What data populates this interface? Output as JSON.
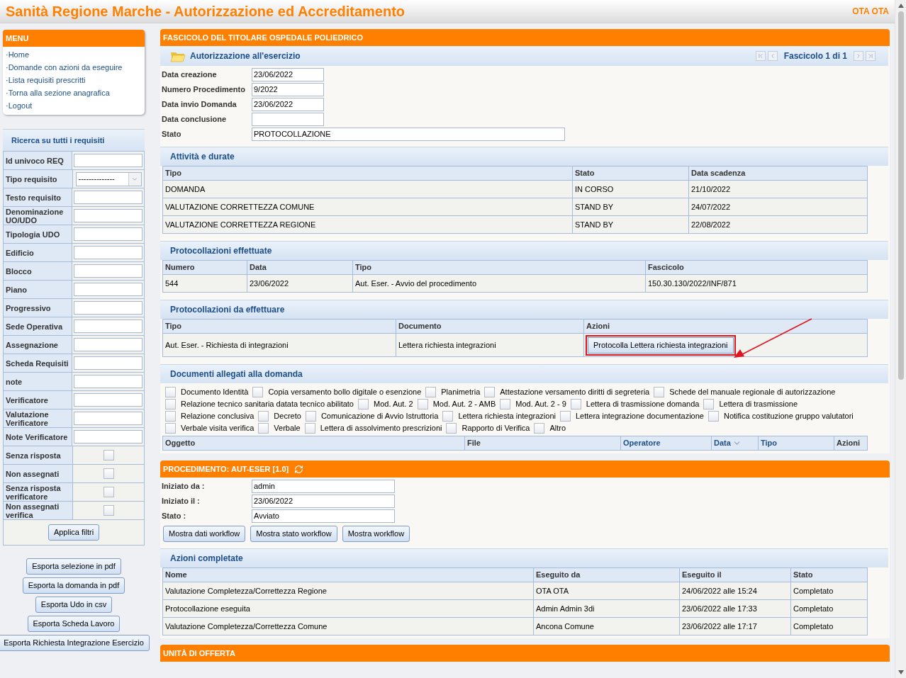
{
  "header": {
    "title": "Sanità Regione Marche - Autorizzazione ed Accreditamento",
    "user": "OTA OTA"
  },
  "menu": {
    "title": "MENU",
    "items": [
      "·Home",
      "·Domande con azioni da eseguire",
      "·Lista requisiti prescritti",
      "·Torna alla sezione anagrafica",
      "·Logout"
    ]
  },
  "search": {
    "title": "Ricerca su tutti i requisiti",
    "filters": [
      {
        "label": "Id univoco REQ",
        "kind": "text"
      },
      {
        "label": "Tipo requisito",
        "kind": "select",
        "value": "--------------"
      },
      {
        "label": "Testo requisito",
        "kind": "text"
      },
      {
        "label": "Denominazione UO/UDO",
        "kind": "text"
      },
      {
        "label": "Tipologia UDO",
        "kind": "text"
      },
      {
        "label": "Edificio",
        "kind": "text"
      },
      {
        "label": "Blocco",
        "kind": "text"
      },
      {
        "label": "Piano",
        "kind": "text"
      },
      {
        "label": "Progressivo",
        "kind": "text"
      },
      {
        "label": "Sede Operativa",
        "kind": "text"
      },
      {
        "label": "Assegnazione",
        "kind": "text"
      },
      {
        "label": "Scheda Requisiti",
        "kind": "text"
      },
      {
        "label": "note",
        "kind": "text"
      },
      {
        "label": "Verificatore",
        "kind": "text"
      },
      {
        "label": "Valutazione Verificatore",
        "kind": "text"
      },
      {
        "label": "Note Verificatore",
        "kind": "text"
      },
      {
        "label": "Senza risposta",
        "kind": "checkbox",
        "checked": false
      },
      {
        "label": "Non assegnati",
        "kind": "checkbox",
        "checked": false
      },
      {
        "label": "Senza risposta verificatore",
        "kind": "checkbox",
        "checked": false
      },
      {
        "label": "Non assegnati verifica",
        "kind": "checkbox",
        "checked": false
      }
    ],
    "apply_button": "Applica filtri"
  },
  "export_buttons": [
    "Esporta selezione in pdf",
    "Esporta la domanda in pdf",
    "Esporta Udo in csv",
    "Esporta Scheda Lavoro",
    "Esporta Richiesta Integrazione Esercizio"
  ],
  "fascicolo": {
    "title": "FASCICOLO DEL TITOLARE OSPEDALE POLIEDRICO",
    "subtitle": "Autorizzazione all'esercizio",
    "pager": "Fascicolo 1 di 1",
    "fields": [
      {
        "label": "Data creazione",
        "value": "23/06/2022",
        "wide": false
      },
      {
        "label": "Numero Procedimento",
        "value": "9/2022",
        "wide": false
      },
      {
        "label": "Data invio Domanda",
        "value": "23/06/2022",
        "wide": false
      },
      {
        "label": "Data conclusione",
        "wide": false
      },
      {
        "label": "Stato",
        "value": "PROTOCOLLAZIONE",
        "wide": true
      }
    ]
  },
  "attivita": {
    "title": "Attività e durate",
    "columns": [
      "Tipo",
      "Stato",
      "Data scadenza"
    ],
    "rows": [
      [
        "DOMANDA",
        "IN CORSO",
        "21/10/2022"
      ],
      [
        "VALUTAZIONE CORRETTEZZA COMUNE",
        "STAND BY",
        "24/07/2022"
      ],
      [
        "VALUTAZIONE CORRETTEZZA REGIONE",
        "STAND BY",
        "22/08/2022"
      ]
    ]
  },
  "protocollazioni_effettuate": {
    "title": "Protocollazioni effettuate",
    "columns": [
      "Numero",
      "Data",
      "Tipo",
      "Fascicolo"
    ],
    "rows": [
      [
        "544",
        "23/06/2022",
        "Aut. Eser. - Avvio del procedimento",
        "150.30.130/2022/INF/871"
      ]
    ]
  },
  "protocollazioni_da_effettuare": {
    "title": "Protocollazioni da effettuare",
    "columns": [
      "Tipo",
      "Documento",
      "Azioni"
    ],
    "rows": [
      {
        "tipo": "Aut. Eser. - Richiesta di integrazioni",
        "documento": "Lettera richiesta integrazioni",
        "action": "Protocolla Lettera richiesta integrazioni",
        "highlighted": true
      }
    ]
  },
  "documenti": {
    "title": "Documenti allegati alla domanda",
    "options": [
      {
        "label": "Documento Identità",
        "checked": false
      },
      {
        "label": "Copia versamento bollo digitale o esenzione",
        "checked": false
      },
      {
        "label": "Planimetria",
        "checked": false
      },
      {
        "label": "Attestazione versamento diritti di segreteria",
        "checked": false
      },
      {
        "label": "Schede del manuale regionale di autorizzazione",
        "checked": false
      },
      {
        "label": "Relazione tecnico sanitaria datata tecnico abilitato",
        "checked": false
      },
      {
        "label": "Mod. Aut. 2",
        "checked": false
      },
      {
        "label": "Mod. Aut. 2 - AMB",
        "checked": false
      },
      {
        "label": "Mod. Aut. 2 - 9",
        "checked": false
      },
      {
        "label": "Lettera di trasmissione domanda",
        "checked": false
      },
      {
        "label": "Lettera di trasmissione",
        "checked": false
      },
      {
        "label": "Relazione conclusiva",
        "checked": false
      },
      {
        "label": "Decreto",
        "checked": false
      },
      {
        "label": "Comunicazione di Avvio Istruttoria",
        "checked": false
      },
      {
        "label": "Lettera richiesta integrazioni",
        "checked": false
      },
      {
        "label": "Lettera integrazione documentazione",
        "checked": false
      },
      {
        "label": "Notifica costituzione gruppo valutatori",
        "checked": false
      },
      {
        "label": "Verbale visita verifica",
        "checked": false
      },
      {
        "label": "Verbale",
        "checked": false
      },
      {
        "label": "Lettera di assolvimento prescrizioni",
        "checked": false
      },
      {
        "label": "Rapporto di Verifica",
        "checked": false
      },
      {
        "label": "Altro",
        "checked": false
      }
    ],
    "columns": [
      {
        "label": "Oggetto",
        "sorted": false
      },
      {
        "label": "File",
        "sorted": false
      },
      {
        "label": "Operatore",
        "sorted": false
      },
      {
        "label": "Data",
        "sorted": true
      },
      {
        "label": "Tipo",
        "sorted": false
      },
      {
        "label": "Azioni",
        "sorted": false
      }
    ]
  },
  "procedimento": {
    "title": "PROCEDIMENTO: AUT-ESER [1.0]",
    "fields": [
      {
        "label": "Iniziato da :",
        "value": "admin"
      },
      {
        "label": "Iniziato il :",
        "value": "23/06/2022"
      },
      {
        "label": "Stato :",
        "value": "Avviato"
      }
    ],
    "buttons": [
      "Mostra dati workflow",
      "Mostra stato workflow",
      "Mostra workflow"
    ]
  },
  "azioni_completate": {
    "title": "Azioni completate",
    "columns": [
      "Nome",
      "Eseguito da",
      "Eseguito il",
      "Stato"
    ],
    "rows": [
      [
        "Valutazione Completezza/Correttezza Regione",
        "OTA OTA",
        "24/06/2022 alle 15:24",
        "Completato"
      ],
      [
        "Protocollazione eseguita",
        "Admin Admin 3di",
        "23/06/2022 alle 17:33",
        "Completato"
      ],
      [
        "Valutazione Completezza/Correttezza Comune",
        "Ancona Comune",
        "23/06/2022 alle 17:17",
        "Completato"
      ]
    ]
  },
  "unita_offerta": {
    "title": "UNITÀ DI OFFERTA"
  }
}
